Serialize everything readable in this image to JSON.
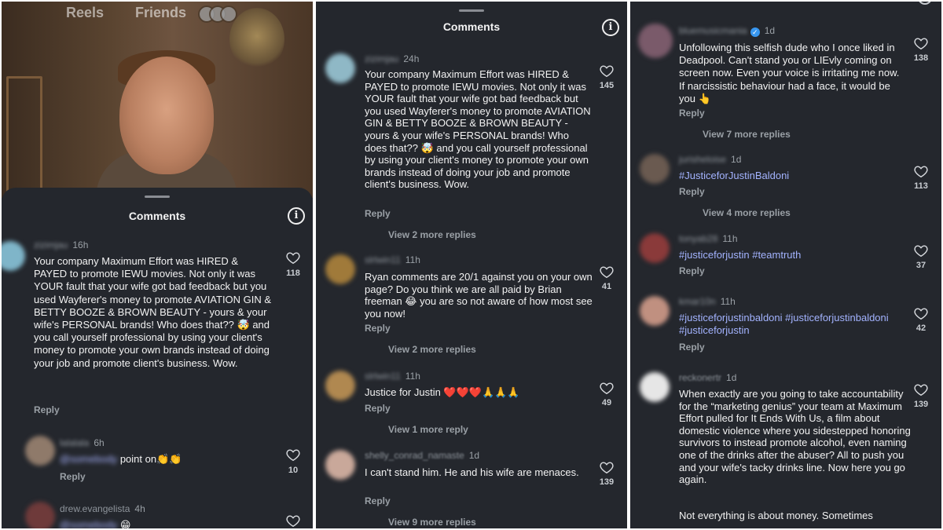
{
  "panel1": {
    "tabs": {
      "reels": "Reels",
      "friends": "Friends"
    },
    "sheet_title": "Comments",
    "comments": [
      {
        "user": "zizimjau",
        "time": "16h",
        "text": "Your company Maximum Effort was HIRED & PAYED to promote IEWU movies. Not only it was YOUR fault that your wife got bad feedback but you used Wayferer's money to promote AVIATION GIN & BETTY BOOZE & BROWN BEAUTY - yours & your wife's PERSONAL brands! Who does that?? 🤯 and you call yourself professional by using your client's money to promote your own brands instead of doing your job and promote client's business. Wow.",
        "reply": "Reply",
        "likes": "118"
      },
      {
        "user": "lalalala",
        "time": "6h",
        "mention": "@somebody",
        "text": "point on👏👏",
        "reply": "Reply",
        "likes": "10"
      },
      {
        "user": "drew.evangelista",
        "time": "4h",
        "mention": "@somebody",
        "text": "😁"
      }
    ]
  },
  "panel2": {
    "sheet_title": "Comments",
    "comments": [
      {
        "user": "zizimjau",
        "time": "24h",
        "text": "Your company Maximum Effort was HIRED & PAYED to promote IEWU movies. Not only it was YOUR fault that your wife got bad feedback but you used Wayferer's money to promote AVIATION GIN & BETTY BOOZE & BROWN BEAUTY - yours & your wife's PERSONAL brands! Who does that?? 🤯 and you call yourself professional by using your client's money to promote your own brands instead of doing your job and promote client's business. Wow.",
        "reply": "Reply",
        "likes": "145",
        "more": "View 2 more replies"
      },
      {
        "user": "slrlwin11",
        "time": "11h",
        "text": "Ryan comments are 20/1 against you on your own page? Do you think we are all paid by Brian freeman 😂 you are so not aware of how most see you now!",
        "reply": "Reply",
        "likes": "41",
        "more": "View 2 more replies"
      },
      {
        "user": "slrlwin11",
        "time": "11h",
        "text": "Justice for Justin ❤️❤️❤️🙏🙏🙏",
        "reply": "Reply",
        "likes": "49",
        "more": "View 1 more reply"
      },
      {
        "user": "shelly_conrad_namaste",
        "time": "1d",
        "text": "I can't stand him. He and his wife are menaces.",
        "reply": "Reply",
        "likes": "139",
        "more": "View 9 more replies"
      }
    ]
  },
  "panel3": {
    "comments": [
      {
        "user": "bluemusicmania",
        "time": "1d",
        "text": "Unfollowing this selfish dude who I once liked in Deadpool. Can't stand you or LIEvly coming on screen now. Even your voice is irritating me now. If narcissistic behaviour had a face, it would be you 👆",
        "reply": "Reply",
        "likes": "138",
        "more": "View 7 more replies"
      },
      {
        "user": "jurisheloise",
        "time": "1d",
        "text": "#JusticeforJustinBaldoni",
        "reply": "Reply",
        "likes": "113",
        "more": "View 4 more replies"
      },
      {
        "user": "tonyab28",
        "time": "11h",
        "text": "#justiceforjustin #teamtruth",
        "reply": "Reply",
        "likes": "37"
      },
      {
        "user": "kmar10n",
        "time": "11h",
        "text": "#justiceforjustinbaldoni #justiceforjustinbaldoni #justiceforjustin",
        "reply": "Reply",
        "likes": "42"
      },
      {
        "user": "reckonertr",
        "time": "1d",
        "text": "When exactly are you going to take accountability for the “marketing genius” your team at Maximum Effort pulled for It Ends With Us,  a film about domestic violence where you sidestepped honoring survivors to instead promote alcohol, even naming one of the drinks after the abuser? All to push you and your wife's tacky drinks line. Now here  you go again.",
        "text2": "Not everything is about money. Sometimes",
        "likes": "139"
      }
    ]
  }
}
